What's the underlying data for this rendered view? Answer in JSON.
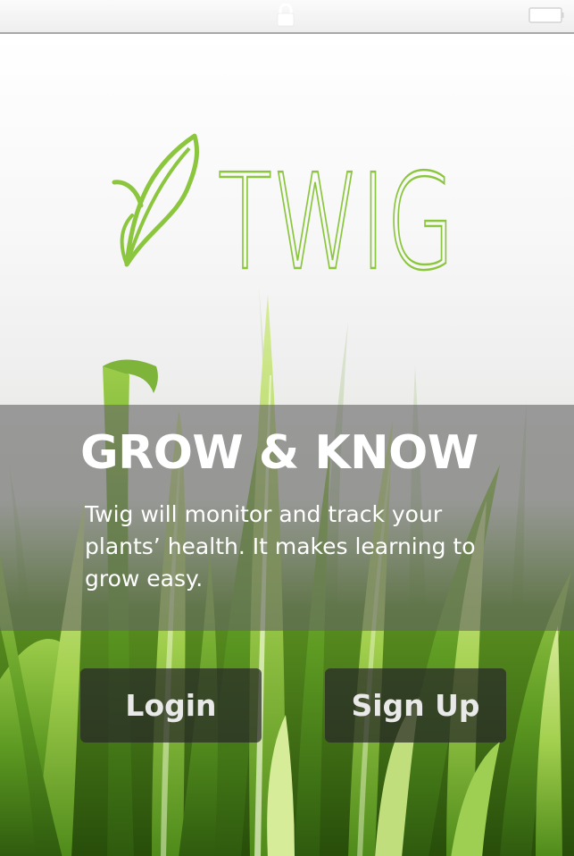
{
  "status_bar": {
    "icons": [
      "lock-icon",
      "battery-icon"
    ]
  },
  "logo": {
    "icon": "leaf-icon",
    "text": "TWIG",
    "color": "#8cc63f"
  },
  "hero": {
    "headline": "GROW & KNOW",
    "description": "Twig will monitor and track your plants’ health. It makes learning to grow easy."
  },
  "actions": {
    "login_label": "Login",
    "signup_label": "Sign Up"
  },
  "colors": {
    "brand_green": "#8cc63f",
    "panel_overlay": "#666666",
    "button_bg": "#282828",
    "button_text": "#e9e9e9"
  }
}
